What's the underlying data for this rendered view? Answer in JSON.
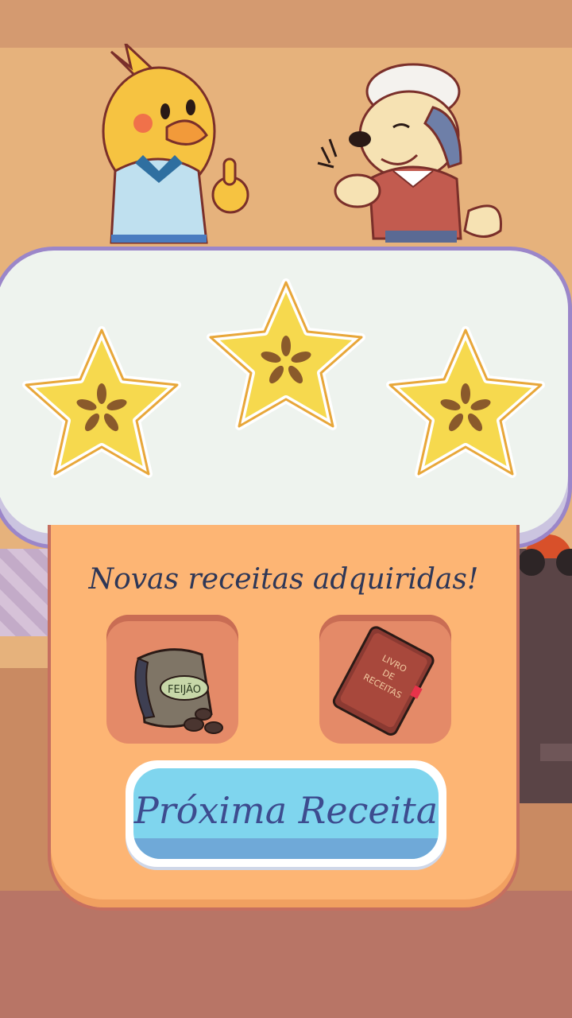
{
  "results": {
    "stars_earned": 3,
    "stars_total": 3
  },
  "rewards": {
    "title": "Novas receitas adquiridas!",
    "items": [
      {
        "name": "feijao",
        "label": "FEIJÃO",
        "icon": "bean-bag-icon"
      },
      {
        "name": "livro-de-receitas",
        "label_lines": [
          "LIVRO",
          "DE",
          "RECEITAS"
        ],
        "icon": "recipe-book-icon"
      }
    ]
  },
  "next_button": {
    "label": "Próxima Receita"
  },
  "characters": [
    "chick-chef-character",
    "puppy-chef-character"
  ],
  "colors": {
    "panel_border": "#9b86c9",
    "star_fill": "#f6d94e",
    "reward_panel": "#fdb574",
    "button_fill": "#7fd5ee",
    "text_dark": "#2e3757"
  }
}
